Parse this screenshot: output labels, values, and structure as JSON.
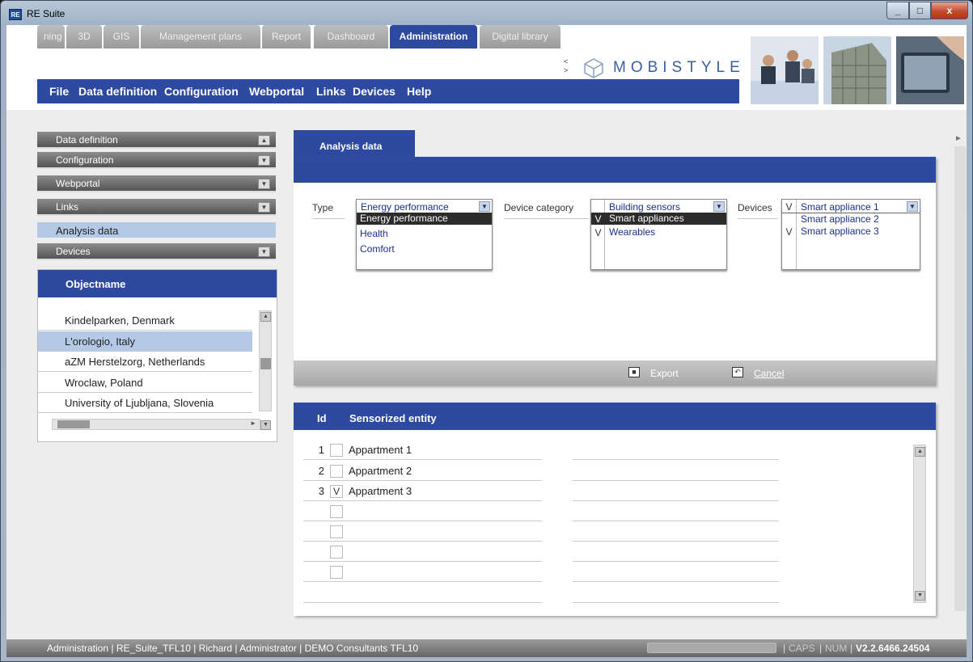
{
  "window": {
    "title": "RE Suite",
    "logo": "RE",
    "controls": {
      "minimize": "_",
      "maximize": "□",
      "close": "x"
    }
  },
  "header": {
    "tabs": [
      {
        "label": "ning"
      },
      {
        "label": "3D"
      },
      {
        "label": "GIS"
      },
      {
        "label": "Management plans"
      },
      {
        "label": "Report"
      },
      {
        "label": "Dashboard"
      },
      {
        "label": "Administration",
        "active": true
      },
      {
        "label": "Digital library"
      }
    ],
    "tab_scroll_left": "<",
    "tab_scroll_right": ">",
    "brand": "MOBISTYLE",
    "menu": [
      "File",
      "Data definition",
      "Configuration",
      "Webportal",
      "Links",
      "Devices",
      "Help"
    ]
  },
  "sidebar": {
    "items": [
      {
        "label": "Data definition",
        "toggle": "▲"
      },
      {
        "label": "Configuration",
        "toggle": "▼"
      },
      {
        "label": "Webportal",
        "toggle": "▼"
      },
      {
        "label": "Links",
        "toggle": "▼"
      },
      {
        "label": "Analysis data",
        "toggle": ""
      },
      {
        "label": "Devices",
        "toggle": "▼"
      }
    ],
    "objects": {
      "header": "Objectname",
      "rows": [
        {
          "name": "Kindelparken, Denmark"
        },
        {
          "name": "L'orologio, Italy",
          "selected": true
        },
        {
          "name": "aZM Herstelzorg, Netherlands"
        },
        {
          "name": "Wroclaw, Poland"
        },
        {
          "name": "University of Ljubljana, Slovenia"
        }
      ]
    }
  },
  "analysis": {
    "tab_label": "Analysis data",
    "type": {
      "label": "Type",
      "value": "Energy performance",
      "options": [
        {
          "label": "Energy performance",
          "highlighted": true
        },
        {
          "label": "Health"
        },
        {
          "label": "Comfort"
        }
      ]
    },
    "device_category": {
      "label": "Device category",
      "value": "Building sensors",
      "options": [
        {
          "label": "Smart appliances",
          "checked": "V",
          "highlighted": true
        },
        {
          "label": "Wearables",
          "checked": "V"
        }
      ]
    },
    "devices": {
      "label": "Devices",
      "value": "Smart appliance 1",
      "value_checked": "V",
      "options": [
        {
          "label": "Smart appliance 2",
          "checked": ""
        },
        {
          "label": "Smart appliance 3",
          "checked": "V"
        }
      ]
    },
    "export_label": "Export",
    "cancel_label": "Cancel"
  },
  "entities": {
    "headers": {
      "id": "Id",
      "name": "Sensorized entity"
    },
    "rows": [
      {
        "id": "1",
        "checked": "",
        "name": "Appartment 1"
      },
      {
        "id": "2",
        "checked": "",
        "name": "Appartment 2"
      },
      {
        "id": "3",
        "checked": "V",
        "name": "Appartment 3"
      },
      {
        "id": "",
        "checked": "",
        "name": ""
      },
      {
        "id": "",
        "checked": "",
        "name": ""
      },
      {
        "id": "",
        "checked": "",
        "name": ""
      },
      {
        "id": "",
        "checked": "",
        "name": ""
      }
    ]
  },
  "status": {
    "left": "Administration | RE_Suite_TFL10 | Richard | Administrator | DEMO Consultants TFL10",
    "caps": "CAPS",
    "num": "NUM",
    "version": "V2.2.6466.24504"
  },
  "colors": {
    "accent": "#2d4aa0",
    "selection": "#b3c9e6",
    "status_bar": "#777777"
  }
}
